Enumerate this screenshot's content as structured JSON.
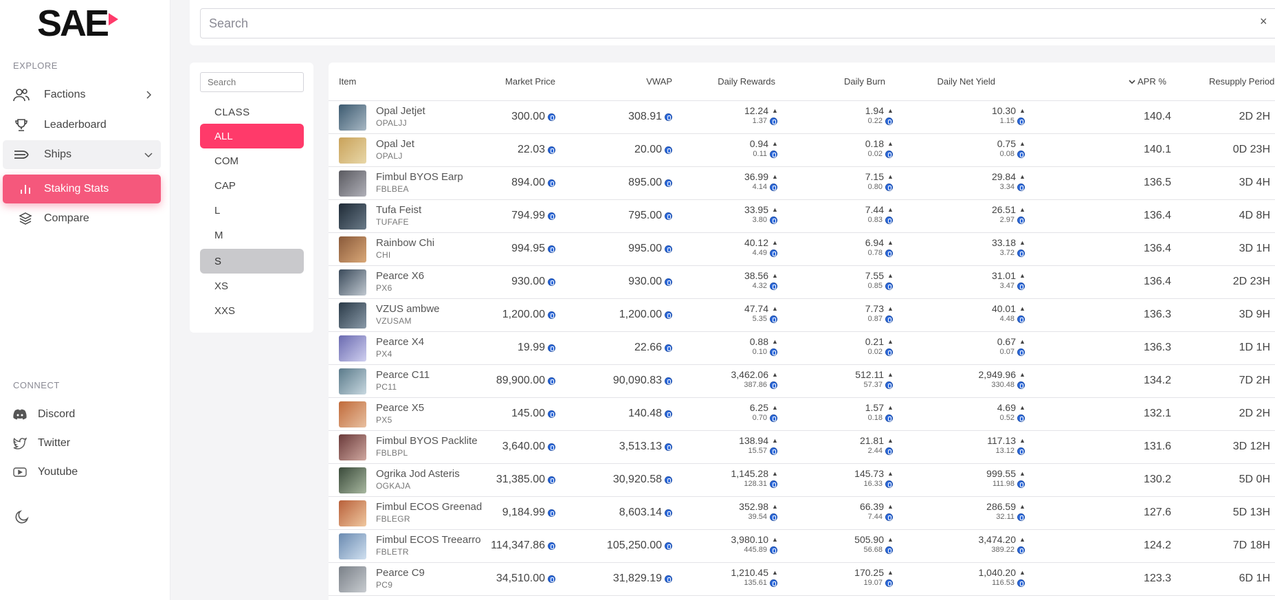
{
  "sidebar": {
    "logo": "SAE",
    "explore_label": "EXPLORE",
    "nav": [
      {
        "label": "Factions",
        "icon": "users-icon",
        "chevron": "right"
      },
      {
        "label": "Leaderboard",
        "icon": "trophy-icon"
      },
      {
        "label": "Ships",
        "icon": "ships-icon",
        "chevron": "down",
        "state": "expanded"
      },
      {
        "label": "Staking Stats",
        "icon": "bar-chart-icon",
        "state": "active"
      },
      {
        "label": "Compare",
        "icon": "layers-icon"
      }
    ],
    "connect_label": "CONNECT",
    "connect": [
      {
        "label": "Discord",
        "icon": "discord-icon"
      },
      {
        "label": "Twitter",
        "icon": "twitter-icon"
      },
      {
        "label": "Youtube",
        "icon": "youtube-icon"
      }
    ],
    "theme_icon": "moon-icon"
  },
  "search": {
    "placeholder": "Search",
    "clear": "×"
  },
  "filter": {
    "search_placeholder": "Search",
    "class_label": "CLASS",
    "classes": [
      "ALL",
      "COM",
      "CAP",
      "L",
      "M",
      "S",
      "XS",
      "XXS"
    ],
    "active": "ALL",
    "hovered": "S"
  },
  "table": {
    "columns": [
      "Item",
      "Market Price",
      "VWAP",
      "Daily Rewards",
      "Daily Burn",
      "Daily Net Yield",
      "APR %",
      "Resupply Period"
    ],
    "sort_column": "APR %",
    "sort_icon": "chevron-down-icon",
    "colors": {
      "accent": "#ff3a6a",
      "coin": "#2f6bdc"
    },
    "rows": [
      {
        "name": "Opal Jetjet",
        "sym": "OPALJJ",
        "price": "300.00",
        "vwap": "308.91",
        "rewards": "12.24",
        "rewards_sub": "1.37",
        "burn": "1.94",
        "burn_sub": "0.22",
        "net": "10.30",
        "net_sub": "1.15",
        "apr": "140.4",
        "period": "2D 2H"
      },
      {
        "name": "Opal Jet",
        "sym": "OPALJ",
        "price": "22.03",
        "vwap": "20.00",
        "rewards": "0.94",
        "rewards_sub": "0.11",
        "burn": "0.18",
        "burn_sub": "0.02",
        "net": "0.75",
        "net_sub": "0.08",
        "apr": "140.1",
        "period": "0D 23H"
      },
      {
        "name": "Fimbul BYOS Earp",
        "sym": "FBLBEA",
        "price": "894.00",
        "vwap": "895.00",
        "rewards": "36.99",
        "rewards_sub": "4.14",
        "burn": "7.15",
        "burn_sub": "0.80",
        "net": "29.84",
        "net_sub": "3.34",
        "apr": "136.5",
        "period": "3D 4H"
      },
      {
        "name": "Tufa Feist",
        "sym": "TUFAFE",
        "price": "794.99",
        "vwap": "795.00",
        "rewards": "33.95",
        "rewards_sub": "3.80",
        "burn": "7.44",
        "burn_sub": "0.83",
        "net": "26.51",
        "net_sub": "2.97",
        "apr": "136.4",
        "period": "4D 8H"
      },
      {
        "name": "Rainbow Chi",
        "sym": "CHI",
        "price": "994.95",
        "vwap": "995.00",
        "rewards": "40.12",
        "rewards_sub": "4.49",
        "burn": "6.94",
        "burn_sub": "0.78",
        "net": "33.18",
        "net_sub": "3.72",
        "apr": "136.4",
        "period": "3D 1H"
      },
      {
        "name": "Pearce X6",
        "sym": "PX6",
        "price": "930.00",
        "vwap": "930.00",
        "rewards": "38.56",
        "rewards_sub": "4.32",
        "burn": "7.55",
        "burn_sub": "0.85",
        "net": "31.01",
        "net_sub": "3.47",
        "apr": "136.4",
        "period": "2D 23H"
      },
      {
        "name": "VZUS ambwe",
        "sym": "VZUSAM",
        "price": "1,200.00",
        "vwap": "1,200.00",
        "rewards": "47.74",
        "rewards_sub": "5.35",
        "burn": "7.73",
        "burn_sub": "0.87",
        "net": "40.01",
        "net_sub": "4.48",
        "apr": "136.3",
        "period": "3D 9H"
      },
      {
        "name": "Pearce X4",
        "sym": "PX4",
        "price": "19.99",
        "vwap": "22.66",
        "rewards": "0.88",
        "rewards_sub": "0.10",
        "burn": "0.21",
        "burn_sub": "0.02",
        "net": "0.67",
        "net_sub": "0.07",
        "apr": "136.3",
        "period": "1D 1H"
      },
      {
        "name": "Pearce C11",
        "sym": "PC11",
        "price": "89,900.00",
        "vwap": "90,090.83",
        "rewards": "3,462.06",
        "rewards_sub": "387.86",
        "burn": "512.11",
        "burn_sub": "57.37",
        "net": "2,949.96",
        "net_sub": "330.48",
        "apr": "134.2",
        "period": "7D 2H"
      },
      {
        "name": "Pearce X5",
        "sym": "PX5",
        "price": "145.00",
        "vwap": "140.48",
        "rewards": "6.25",
        "rewards_sub": "0.70",
        "burn": "1.57",
        "burn_sub": "0.18",
        "net": "4.69",
        "net_sub": "0.52",
        "apr": "132.1",
        "period": "2D 2H"
      },
      {
        "name": "Fimbul BYOS Packlite",
        "sym": "FBLBPL",
        "price": "3,640.00",
        "vwap": "3,513.13",
        "rewards": "138.94",
        "rewards_sub": "15.57",
        "burn": "21.81",
        "burn_sub": "2.44",
        "net": "117.13",
        "net_sub": "13.12",
        "apr": "131.6",
        "period": "3D 12H"
      },
      {
        "name": "Ogrika Jod Asteris",
        "sym": "OGKAJA",
        "price": "31,385.00",
        "vwap": "30,920.58",
        "rewards": "1,145.28",
        "rewards_sub": "128.31",
        "burn": "145.73",
        "burn_sub": "16.33",
        "net": "999.55",
        "net_sub": "111.98",
        "apr": "130.2",
        "period": "5D 0H"
      },
      {
        "name": "Fimbul ECOS Greenad",
        "sym": "FBLEGR",
        "price": "9,184.99",
        "vwap": "8,603.14",
        "rewards": "352.98",
        "rewards_sub": "39.54",
        "burn": "66.39",
        "burn_sub": "7.44",
        "net": "286.59",
        "net_sub": "32.11",
        "apr": "127.6",
        "period": "5D 13H"
      },
      {
        "name": "Fimbul ECOS Treearro",
        "sym": "FBLETR",
        "price": "114,347.86",
        "vwap": "105,250.00",
        "rewards": "3,980.10",
        "rewards_sub": "445.89",
        "burn": "505.90",
        "burn_sub": "56.68",
        "net": "3,474.20",
        "net_sub": "389.22",
        "apr": "124.2",
        "period": "7D 18H"
      },
      {
        "name": "Pearce C9",
        "sym": "PC9",
        "price": "34,510.00",
        "vwap": "31,829.19",
        "rewards": "1,210.45",
        "rewards_sub": "135.61",
        "burn": "170.25",
        "burn_sub": "19.07",
        "net": "1,040.20",
        "net_sub": "116.53",
        "apr": "123.3",
        "period": "6D 1H"
      }
    ]
  }
}
